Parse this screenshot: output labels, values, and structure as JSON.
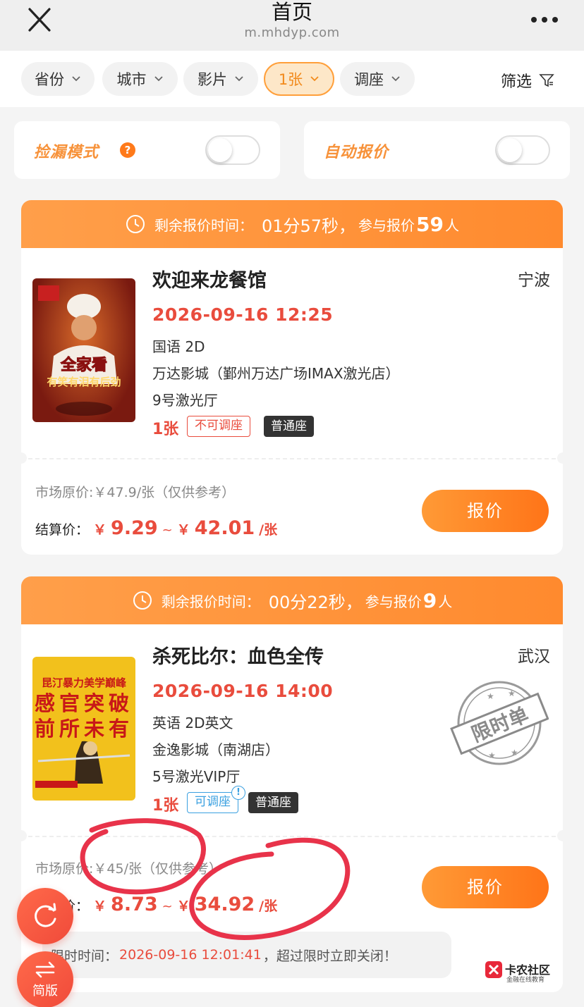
{
  "header": {
    "title": "首页",
    "url": "m.mhdyp.com"
  },
  "filters": {
    "chips": [
      {
        "label": "省份",
        "active": false
      },
      {
        "label": "城市",
        "active": false
      },
      {
        "label": "影片",
        "active": false
      },
      {
        "label": "1张",
        "active": true
      },
      {
        "label": "调座",
        "active": false
      }
    ],
    "filter_label": "筛选"
  },
  "toggles": {
    "bargain_mode": {
      "label": "捡漏模式",
      "help": "?",
      "on": false
    },
    "auto_quote": {
      "label": "自动报价",
      "on": false
    }
  },
  "listings": [
    {
      "countdown_prefix": "剩余报价时间：",
      "countdown": "01分57秒，",
      "participants_prefix": "参与报价",
      "participants": "59",
      "participants_suffix": "人",
      "poster_caption_1": "全家看",
      "poster_caption_2": "有笑有泪有后劲",
      "title": "欢迎来龙餐馆",
      "city": "宁波",
      "showtime": "2026-09-16 12:25",
      "language": "国语 2D",
      "cinema": "万达影城（鄞州万达广场IMAX激光店）",
      "hall": "9号激光厅",
      "tickets": "1张",
      "seat_adjust": "不可调座",
      "seat_type": "普通座",
      "market_price": "市场原价:￥47.9/张（仅供参考）",
      "settle_label": "结算价：",
      "yen": "￥",
      "price_low": "9.29",
      "price_sep": "~",
      "price_high": "42.01",
      "price_unit": "/张",
      "button": "报价"
    },
    {
      "countdown_prefix": "剩余报价时间：",
      "countdown": "00分22秒，",
      "participants_prefix": "参与报价",
      "participants": "9",
      "participants_suffix": "人",
      "poster_caption_1": "昆汀暴力美学巅峰",
      "poster_caption_2": "感官突破",
      "poster_caption_3": "前所未有",
      "title": "杀死比尔：血色全传",
      "city": "武汉",
      "showtime": "2026-09-16 14:00",
      "language": "英语 2D英文",
      "cinema": "金逸影城（南湖店）",
      "hall": "5号激光VIP厅",
      "tickets": "1张",
      "seat_adjust": "可调座",
      "seat_adjust_info": "!",
      "seat_type": "普通座",
      "stamp": "限时单",
      "market_price": "市场原价:￥45/张（仅供参考）",
      "settle_label": "结算价：",
      "yen": "￥",
      "price_low": "8.73",
      "price_sep": "~",
      "price_high": "34.92",
      "price_unit": "/张",
      "button": "报价",
      "limit_prefix": "限时时间：",
      "limit_time": "2026-09-16 12:01:41",
      "limit_suffix": "，超过限时立即关闭！"
    }
  ],
  "fabs": {
    "refresh": "refresh-icon",
    "simple": "简版"
  },
  "watermark": {
    "main": "卡农社区",
    "sub": "金融在线教育"
  },
  "colors": {
    "accent": "#ff8a2e",
    "price": "#e94c3d",
    "annotation": "#e8334a"
  }
}
